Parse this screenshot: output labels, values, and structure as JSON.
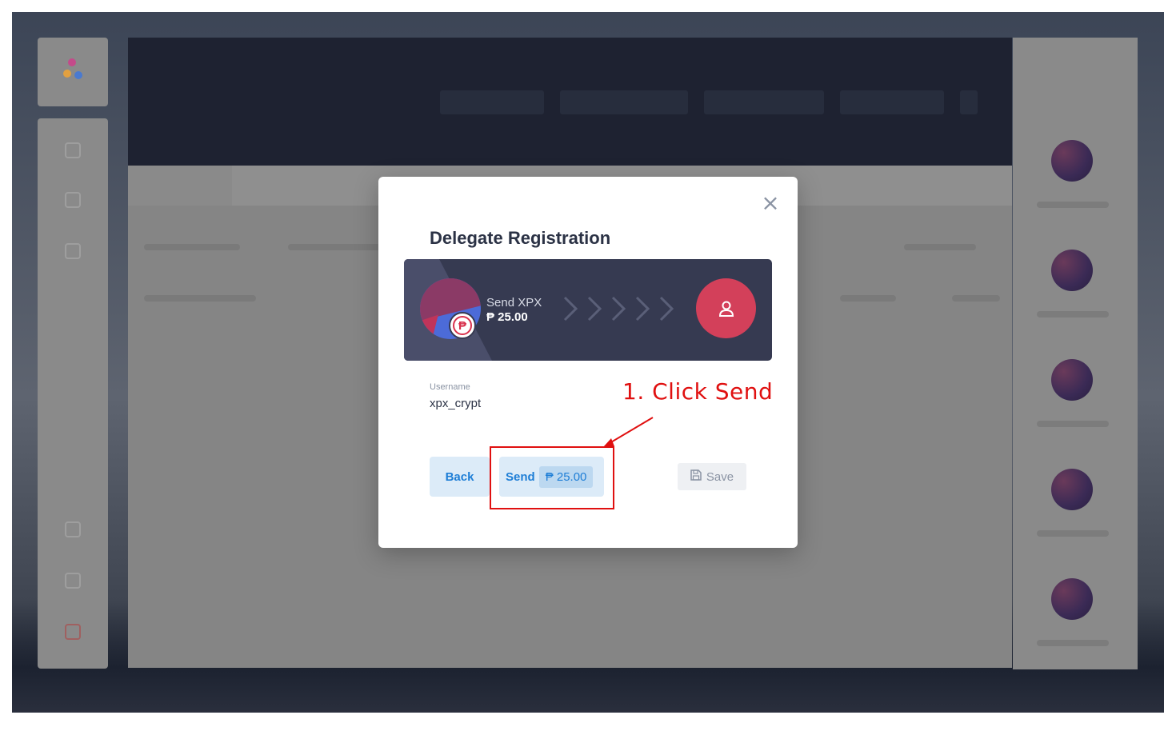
{
  "modal": {
    "title": "Delegate Registration",
    "close_icon": "close-icon",
    "banner": {
      "send_label": "Send XPX",
      "send_amount": "₱ 25.00",
      "currency_symbol": "₱",
      "icon": "user-icon"
    },
    "username_label": "Username",
    "username_value": "xpx_crypt",
    "back_label": "Back",
    "send_button_label": "Send",
    "send_button_amount": "₱ 25.00",
    "save_label": "Save",
    "save_icon": "save-icon"
  },
  "annotation": {
    "hint_text": "1. Click Send",
    "color": "#e01010"
  },
  "colors": {
    "banner_bg": "#363a51",
    "accent_blue": "#1e7ed6",
    "delegate_red": "#d3405a"
  }
}
